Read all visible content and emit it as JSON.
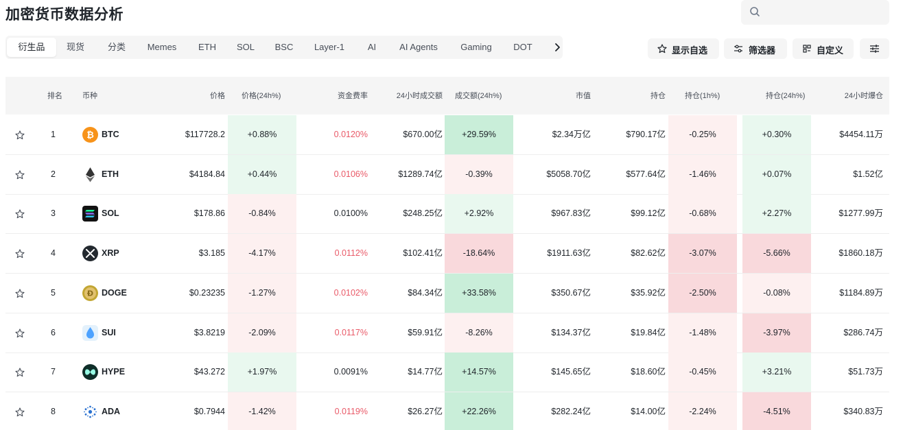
{
  "page": {
    "title": "加密货币数据分析"
  },
  "search": {
    "placeholder": ""
  },
  "tabs": [
    "衍生品",
    "现货",
    "分类",
    "Memes",
    "ETH",
    "SOL",
    "BSC",
    "Layer-1",
    "AI",
    "AI Agents",
    "Gaming",
    "DOT"
  ],
  "active_tab": "衍生品",
  "toolbar": {
    "watchlist": "显示自选",
    "filter": "筛选器",
    "customize": "自定义"
  },
  "columns": [
    "排名",
    "币种",
    "价格",
    "价格(24h%)",
    "资金费率",
    "24小时成交额",
    "成交额(24h%)",
    "市值",
    "持仓",
    "持仓(1h%)",
    "持仓(24h%)",
    "24小时爆仓"
  ],
  "colors": {
    "positive_bg": "#e9f8ef",
    "positive_strong_bg": "#c9eed9",
    "negative_bg": "#fdf0f0",
    "negative_strong_bg": "#f9d9dc",
    "funding_red": "#e95a68"
  },
  "rows": [
    {
      "rank": "1",
      "symbol": "BTC",
      "icon": "btc-icon",
      "price": "$117728.2",
      "price_change": "+0.88%",
      "funding": "0.0120%",
      "volume": "$670.00亿",
      "volume_change": "+29.59%",
      "market_cap": "$2.34万亿",
      "oi": "$790.17亿",
      "oi_1h": "-0.25%",
      "oi_24h": "+0.30%",
      "liquidation": "$4454.11万"
    },
    {
      "rank": "2",
      "symbol": "ETH",
      "icon": "eth-icon",
      "price": "$4184.84",
      "price_change": "+0.44%",
      "funding": "0.0106%",
      "volume": "$1289.74亿",
      "volume_change": "-0.39%",
      "market_cap": "$5058.70亿",
      "oi": "$577.64亿",
      "oi_1h": "-1.46%",
      "oi_24h": "+0.07%",
      "liquidation": "$1.52亿"
    },
    {
      "rank": "3",
      "symbol": "SOL",
      "icon": "sol-icon",
      "price": "$178.86",
      "price_change": "-0.84%",
      "funding": "0.0100%",
      "volume": "$248.25亿",
      "volume_change": "+2.92%",
      "market_cap": "$967.83亿",
      "oi": "$99.12亿",
      "oi_1h": "-0.68%",
      "oi_24h": "+2.27%",
      "liquidation": "$1277.99万"
    },
    {
      "rank": "4",
      "symbol": "XRP",
      "icon": "xrp-icon",
      "price": "$3.185",
      "price_change": "-4.17%",
      "funding": "0.0112%",
      "volume": "$102.41亿",
      "volume_change": "-18.64%",
      "market_cap": "$1911.63亿",
      "oi": "$82.62亿",
      "oi_1h": "-3.07%",
      "oi_24h": "-5.66%",
      "liquidation": "$1860.18万"
    },
    {
      "rank": "5",
      "symbol": "DOGE",
      "icon": "doge-icon",
      "price": "$0.23235",
      "price_change": "-1.27%",
      "funding": "0.0102%",
      "volume": "$84.34亿",
      "volume_change": "+33.58%",
      "market_cap": "$350.67亿",
      "oi": "$35.92亿",
      "oi_1h": "-2.50%",
      "oi_24h": "-0.08%",
      "liquidation": "$1184.89万"
    },
    {
      "rank": "6",
      "symbol": "SUI",
      "icon": "sui-icon",
      "price": "$3.8219",
      "price_change": "-2.09%",
      "funding": "0.0117%",
      "volume": "$59.91亿",
      "volume_change": "-8.26%",
      "market_cap": "$134.37亿",
      "oi": "$19.84亿",
      "oi_1h": "-1.48%",
      "oi_24h": "-3.97%",
      "liquidation": "$286.74万"
    },
    {
      "rank": "7",
      "symbol": "HYPE",
      "icon": "hype-icon",
      "price": "$43.272",
      "price_change": "+1.97%",
      "funding": "0.0091%",
      "volume": "$14.77亿",
      "volume_change": "+14.57%",
      "market_cap": "$145.65亿",
      "oi": "$18.60亿",
      "oi_1h": "-0.45%",
      "oi_24h": "+3.21%",
      "liquidation": "$51.73万"
    },
    {
      "rank": "8",
      "symbol": "ADA",
      "icon": "ada-icon",
      "price": "$0.7944",
      "price_change": "-1.42%",
      "funding": "0.0119%",
      "volume": "$26.27亿",
      "volume_change": "+22.26%",
      "market_cap": "$282.24亿",
      "oi": "$14.00亿",
      "oi_1h": "-2.24%",
      "oi_24h": "-4.51%",
      "liquidation": "$340.83万"
    }
  ]
}
